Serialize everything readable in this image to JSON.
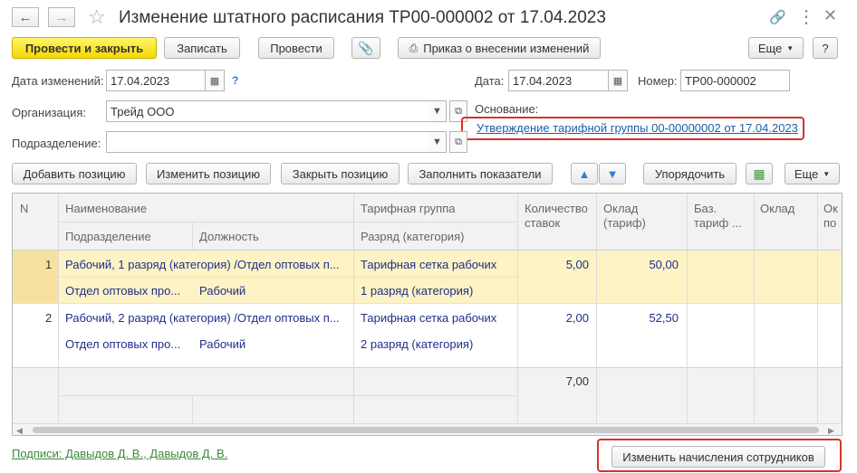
{
  "window": {
    "title": "Изменение штатного расписания ТР00-000002 от 17.04.2023"
  },
  "toolbar": {
    "post_close": "Провести и закрыть",
    "save": "Записать",
    "post": "Провести",
    "order": "Приказ о внесении изменений",
    "more": "Еще",
    "help": "?"
  },
  "form": {
    "change_date_label": "Дата изменений:",
    "change_date": "17.04.2023",
    "date_label": "Дата:",
    "date": "17.04.2023",
    "number_label": "Номер:",
    "number": "ТР00-000002",
    "org_label": "Организация:",
    "org": "Трейд ООО",
    "basis_label": "Основание:",
    "basis_link": "Утверждение тарифной группы 00-00000002 от 17.04.2023",
    "dept_label": "Подразделение:",
    "dept": ""
  },
  "table_toolbar": {
    "add": "Добавить позицию",
    "edit": "Изменить позицию",
    "close": "Закрыть позицию",
    "fill": "Заполнить показатели",
    "sort": "Упорядочить",
    "more": "Еще"
  },
  "table": {
    "headers": {
      "n": "N",
      "name": "Наименование",
      "subdivision": "Подразделение",
      "position": "Должность",
      "tariff_group": "Тарифная группа",
      "grade": "Разряд (категория)",
      "rates_1": "Количество",
      "rates_2": "ставок",
      "salary_1": "Оклад",
      "salary_2": "(тариф)",
      "base_1": "Баз.",
      "base_2": "тариф ...",
      "salary2": "Оклад",
      "extra_1": "Ок",
      "extra_2": "по"
    },
    "rows": [
      {
        "n": "1",
        "name": "Рабочий, 1 разряд (категория) /Отдел оптовых п...",
        "subdivision": "Отдел оптовых про...",
        "position": "Рабочий",
        "tariff_group": "Тарифная сетка рабочих",
        "grade": "1 разряд (категория)",
        "rates": "5,00",
        "salary": "50,00"
      },
      {
        "n": "2",
        "name": "Рабочий, 2 разряд (категория) /Отдел оптовых п...",
        "subdivision": "Отдел оптовых про...",
        "position": "Рабочий",
        "tariff_group": "Тарифная сетка рабочих",
        "grade": "2 разряд (категория)",
        "rates": "2,00",
        "salary": "52,50"
      }
    ],
    "total_rates": "7,00"
  },
  "footer": {
    "signatures": "Подписи: Давыдов Д. В., Давыдов Д. В.",
    "change_accruals": "Изменить начисления сотрудников"
  },
  "colors": {
    "accent_yellow": "#f5d800",
    "selected_row": "#fdf3c4",
    "highlight": "#d9312b",
    "link": "#1d5fa8"
  }
}
